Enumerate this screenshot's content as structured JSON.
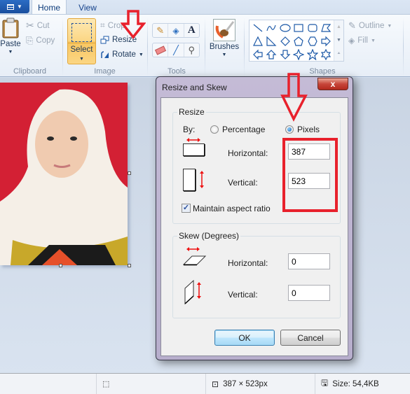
{
  "ribbon": {
    "app_menu_icon": "paint-menu-icon",
    "tabs": [
      {
        "label": "Home",
        "active": true
      },
      {
        "label": "View",
        "active": false
      }
    ],
    "clipboard": {
      "paste_label": "Paste",
      "cut_label": "Cut",
      "copy_label": "Copy",
      "group_label": "Clipboard"
    },
    "image": {
      "select_label": "Select",
      "crop_label": "Crop",
      "resize_label": "Resize",
      "rotate_label": "Rotate",
      "group_label": "Image"
    },
    "tools": {
      "items": [
        "pencil-icon",
        "fill-bucket-icon",
        "text-icon",
        "eraser-icon",
        "color-picker-icon",
        "magnifier-icon"
      ],
      "group_label": "Tools"
    },
    "brushes_label": "Brushes",
    "shapes": {
      "items": [
        "line",
        "curve",
        "oval",
        "rectangle",
        "rounded-rectangle",
        "polygon",
        "triangle",
        "right-triangle",
        "diamond",
        "pentagon",
        "hexagon",
        "right-arrow",
        "left-arrow",
        "up-arrow",
        "down-arrow",
        "four-point-star",
        "five-point-star",
        "six-point-star"
      ],
      "outline_label": "Outline",
      "fill_label": "Fill",
      "group_label": "Shapes"
    }
  },
  "dialog": {
    "title": "Resize and Skew",
    "close_label": "x",
    "resize": {
      "legend": "Resize",
      "by_label": "By:",
      "percentage_label": "Percentage",
      "pixels_label": "Pixels",
      "selected_mode": "Pixels",
      "horizontal_label": "Horizontal:",
      "horizontal_value": "387",
      "vertical_label": "Vertical:",
      "vertical_value": "523",
      "maintain_aspect_label": "Maintain aspect ratio",
      "maintain_aspect_checked": true
    },
    "skew": {
      "legend": "Skew (Degrees)",
      "horizontal_label": "Horizontal:",
      "horizontal_value": "0",
      "vertical_label": "Vertical:",
      "vertical_value": "0"
    },
    "ok_label": "OK",
    "cancel_label": "Cancel"
  },
  "statusbar": {
    "dimensions": "387 × 523px",
    "size": "Size: 54,4KB"
  },
  "annotations": {
    "color": "#e8212c"
  }
}
